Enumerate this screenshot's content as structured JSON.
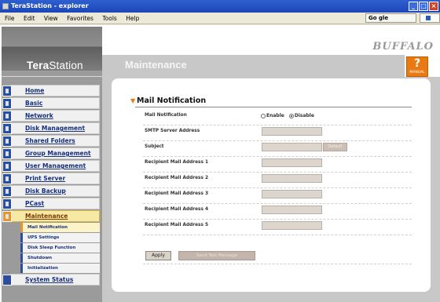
{
  "window": {
    "title": "TeraStation - explorer"
  },
  "menubar": {
    "items": [
      "File",
      "Edit",
      "View",
      "Favorites",
      "Tools",
      "Help"
    ],
    "search_brand": "Go gle"
  },
  "brand": {
    "logo_bold": "Tera",
    "logo_light": "Station",
    "vendor": "BUFFALO",
    "manual_glyph": "?",
    "manual_label": "MANUAL"
  },
  "page": {
    "title": "Maintenance"
  },
  "nav": {
    "items": [
      {
        "label": "Home",
        "icon": "home-icon"
      },
      {
        "label": "Basic",
        "icon": "basic-icon"
      },
      {
        "label": "Network",
        "icon": "network-icon"
      },
      {
        "label": "Disk Management",
        "icon": "disk-icon"
      },
      {
        "label": "Shared Folders",
        "icon": "folder-icon"
      },
      {
        "label": "Group Management",
        "icon": "group-icon"
      },
      {
        "label": "User Management",
        "icon": "user-icon"
      },
      {
        "label": "Print Server",
        "icon": "printer-icon"
      },
      {
        "label": "Disk Backup",
        "icon": "backup-icon"
      },
      {
        "label": "PCast",
        "icon": "pcast-icon"
      },
      {
        "label": "Maintenance",
        "icon": "wrench-icon",
        "active": true
      }
    ],
    "sub_items": [
      {
        "label": "Mail Notification",
        "active": true
      },
      {
        "label": "UPS Settings"
      },
      {
        "label": "Disk Sleep Function"
      },
      {
        "label": "Shutdown"
      },
      {
        "label": "Initialization"
      }
    ],
    "status": "System Status"
  },
  "section": {
    "title": "Mail Notification"
  },
  "form": {
    "mail_notification_label": "Mail Notification",
    "enable_label": "Enable",
    "disable_label": "Disable",
    "selected": "Disable",
    "smtp_label": "SMTP Server Address",
    "subject_label": "Subject",
    "subject_button": "Default",
    "recipient1_label": "Recipient Mail Address 1",
    "recipient2_label": "Recipient Mail Address 2",
    "recipient3_label": "Recipient Mail Address 3",
    "recipient4_label": "Recipient Mail Address 4",
    "recipient5_label": "Recipient Mail Address 5"
  },
  "actions": {
    "apply": "Apply",
    "send_test": "Send Test Message"
  },
  "colors": {
    "accent": "#e97a12",
    "nav_link": "#18307a",
    "nav_icon": "#2d4e9e"
  }
}
